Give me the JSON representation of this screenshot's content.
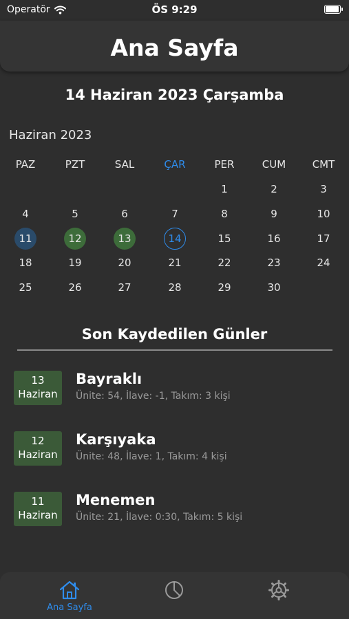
{
  "status_bar": {
    "carrier": "Operatör",
    "time": "ÖS 9:29"
  },
  "nav": {
    "title": "Ana Sayfa"
  },
  "date_header": "14 Haziran 2023 Çarşamba",
  "calendar": {
    "month_label": "Haziran 2023",
    "weekdays": [
      "PAZ",
      "PZT",
      "SAL",
      "ÇAR",
      "PER",
      "CUM",
      "CMT"
    ],
    "selected_weekday": "ÇAR",
    "weeks": [
      [
        "",
        "",
        "",
        "",
        "1",
        "2",
        "3"
      ],
      [
        "4",
        "5",
        "6",
        "7",
        "8",
        "9",
        "10"
      ],
      [
        "11",
        "12",
        "13",
        "14",
        "15",
        "16",
        "17"
      ],
      [
        "18",
        "19",
        "20",
        "21",
        "22",
        "23",
        "24"
      ],
      [
        "25",
        "26",
        "27",
        "28",
        "29",
        "30",
        ""
      ]
    ],
    "highlighted_days": {
      "11": "blue",
      "12": "green",
      "13": "green",
      "14": "today"
    }
  },
  "recent": {
    "title": "Son Kaydedilen Günler",
    "items": [
      {
        "day": "13",
        "month": "Haziran",
        "name": "Bayraklı",
        "detail": "Ünite: 54, İlave: -1, Takım: 3 kişi"
      },
      {
        "day": "12",
        "month": "Haziran",
        "name": "Karşıyaka",
        "detail": "Ünite: 48, İlave: 1, Takım: 4 kişi"
      },
      {
        "day": "11",
        "month": "Haziran",
        "name": "Menemen",
        "detail": "Ünite: 21, İlave: 0:30, Takım: 5 kişi"
      }
    ]
  },
  "tab_bar": {
    "tabs": [
      {
        "label": "Ana Sayfa",
        "icon": "house-icon",
        "active": true
      },
      {
        "label": "",
        "icon": "pie-chart-icon",
        "active": false
      },
      {
        "label": "",
        "icon": "gear-icon",
        "active": false
      }
    ]
  },
  "colors": {
    "accent": "#2f8ceb",
    "background": "#2e2e2e",
    "bar": "#343434",
    "badge": "#3b5a38",
    "mark_blue": "#2a4b6a",
    "mark_green": "#3d6c3a"
  }
}
